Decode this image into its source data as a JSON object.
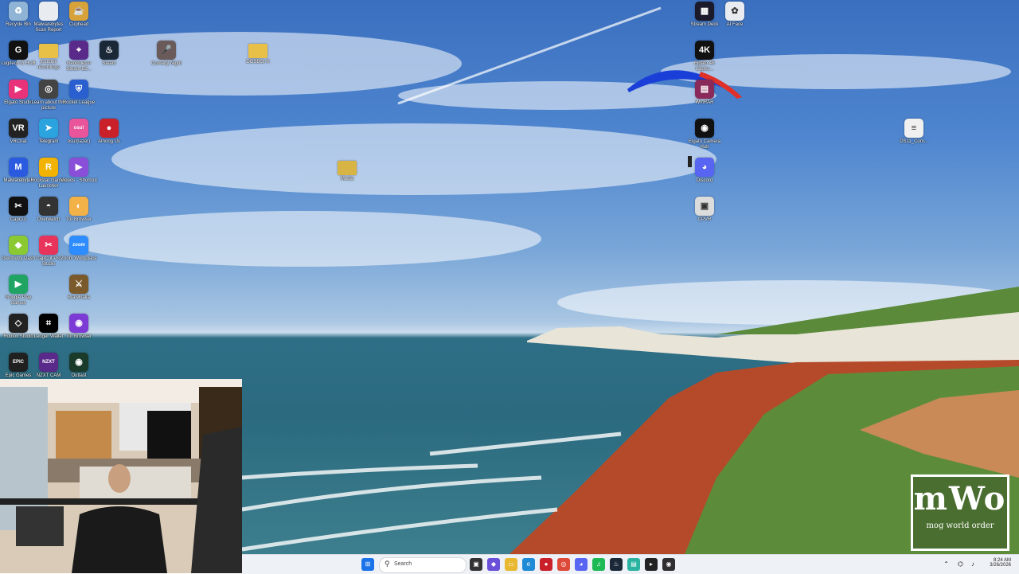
{
  "desktop": {
    "icons": [
      {
        "label": "Recycle Bin",
        "icon": "recycle-bin-icon",
        "color": "#8fb4d6",
        "glyph": "♻"
      },
      {
        "label": "Malwarebytes Scan Report",
        "icon": "document-icon",
        "color": "#e8ecf0",
        "glyph": ""
      },
      {
        "label": "Cuphead",
        "icon": "cuphead-icon",
        "color": "#d8a23a",
        "glyph": "☕"
      },
      {
        "label": "Logitech G HUB",
        "icon": "logitech-ghub-icon",
        "color": "#111111",
        "glyph": "G"
      },
      {
        "label": "youtube recordings",
        "icon": "folder-icon",
        "color": "#e8c048",
        "glyph": ""
      },
      {
        "label": "GeoGuessr Steam Ed...",
        "icon": "geoguessr-icon",
        "color": "#5a2a8a",
        "glyph": "⌖"
      },
      {
        "label": "Steam",
        "icon": "steam-icon",
        "color": "#1b2838",
        "glyph": "♨"
      },
      {
        "label": "Elgato Studio",
        "icon": "elgato-studio-icon",
        "color": "#e8337a",
        "glyph": "▶"
      },
      {
        "label": "Learn about this picture",
        "icon": "camera-icon",
        "color": "#444444",
        "glyph": "◎"
      },
      {
        "label": "Rocket League",
        "icon": "rocket-league-icon",
        "color": "#2a5fcf",
        "glyph": "⛨"
      },
      {
        "label": "VRChat",
        "icon": "vrchat-icon",
        "color": "#222222",
        "glyph": "VR"
      },
      {
        "label": "Telegram",
        "icon": "telegram-icon",
        "color": "#2aa3de",
        "glyph": "➤"
      },
      {
        "label": "osu!(lazer)",
        "icon": "osu-icon",
        "color": "#e9559b",
        "glyph": "osu!"
      },
      {
        "label": "Among Us",
        "icon": "among-us-icon",
        "color": "#c9202a",
        "glyph": "●"
      },
      {
        "label": "Malwarebytes",
        "icon": "malwarebytes-icon",
        "color": "#2a5ae0",
        "glyph": "M"
      },
      {
        "label": "Rockstar Games Launcher",
        "icon": "rockstar-icon",
        "color": "#f2b300",
        "glyph": "R"
      },
      {
        "label": "Videos - Shortcut",
        "icon": "videos-icon",
        "color": "#8a4fd8",
        "glyph": "▶"
      },
      {
        "label": "CapCut",
        "icon": "capcut-icon",
        "color": "#111111",
        "glyph": "✂"
      },
      {
        "label": "Overwatch",
        "icon": "overwatch-icon",
        "color": "#333333",
        "glyph": "◓"
      },
      {
        "label": "Tor Browser",
        "icon": "tor-browser-icon",
        "color": "#f3b247",
        "glyph": "◐"
      },
      {
        "label": "Geometry Dash",
        "icon": "geometry-dash-icon",
        "color": "#8ac932",
        "glyph": "◆"
      },
      {
        "label": "CapCut Pro Studio",
        "icon": "capcut-studio-icon",
        "color": "#e8335a",
        "glyph": "✂"
      },
      {
        "label": "Zoom Workplace",
        "icon": "zoom-icon",
        "color": "#2d8cff",
        "glyph": "zoom"
      },
      {
        "label": "Google Play Games",
        "icon": "google-play-games-icon",
        "color": "#1fa463",
        "glyph": "▶"
      },
      {
        "label": "Brawlhalla",
        "icon": "brawlhalla-icon",
        "color": "#7a5a2a",
        "glyph": "⚔"
      },
      {
        "label": "Roblox Studio",
        "icon": "roblox-studio-icon",
        "color": "#222222",
        "glyph": "◇"
      },
      {
        "label": "Ledger Wallet",
        "icon": "ledger-icon",
        "color": "#000000",
        "glyph": "⌗"
      },
      {
        "label": "Tor Browser",
        "icon": "tor-icon",
        "color": "#7d3bd6",
        "glyph": "◉"
      },
      {
        "label": "Epic Games",
        "icon": "epic-games-icon",
        "color": "#202020",
        "glyph": "EPIC"
      },
      {
        "label": "NZXT CAM",
        "icon": "nzxt-cam-icon",
        "color": "#5a2a8a",
        "glyph": "NZXT"
      },
      {
        "label": "Outlast",
        "icon": "outlast-icon",
        "color": "#1a3a2a",
        "glyph": "◉"
      },
      {
        "label": "Comedy Night",
        "icon": "comedy-night-icon",
        "color": "#6a5a5a",
        "glyph": "🎤"
      },
      {
        "label": "DOSBox-X",
        "icon": "folder-icon",
        "color": "#e8c048",
        "glyph": ""
      },
      {
        "label": "Media",
        "icon": "media-folder-icon",
        "color": "#d8b444",
        "glyph": ""
      },
      {
        "label": "Stream Deck",
        "icon": "stream-deck-icon",
        "color": "#1a1a2a",
        "glyph": "▦"
      },
      {
        "label": "AI Face",
        "icon": "ai-face-icon",
        "color": "#e8ecf0",
        "glyph": "✿"
      },
      {
        "label": "Elgato 4K Captur...",
        "icon": "elgato-4k-icon",
        "color": "#111111",
        "glyph": "4K"
      },
      {
        "label": "WinRAR",
        "icon": "winrar-icon",
        "color": "#8a2a5a",
        "glyph": "▤"
      },
      {
        "label": "Elgato Camera Hub",
        "icon": "elgato-camera-hub-icon",
        "color": "#111111",
        "glyph": "◉"
      },
      {
        "label": "Discord",
        "icon": "discord-icon",
        "color": "#5865f2",
        "glyph": "◕"
      },
      {
        "label": "CPVR",
        "icon": "cpvr-icon",
        "color": "#dcdcdc",
        "glyph": "▣"
      },
      {
        "label": "DS11_Com...",
        "icon": "document-icon",
        "color": "#f0f0f0",
        "glyph": "≡"
      }
    ]
  },
  "watermark": {
    "big": "mWo",
    "small": "mog world order"
  },
  "taskbar": {
    "search_placeholder": "Search",
    "apps": [
      {
        "name": "windows-start-icon",
        "color": "#1a73e8",
        "glyph": "⊞"
      },
      {
        "name": "widgets-icon",
        "color": "#7cb342",
        "glyph": "☘"
      },
      {
        "name": "task-view-icon",
        "color": "#333333",
        "glyph": "▣"
      },
      {
        "name": "copilot-icon",
        "color": "#6a4fd8",
        "glyph": "◆"
      },
      {
        "name": "file-explorer-icon",
        "color": "#e8b830",
        "glyph": "▭"
      },
      {
        "name": "edge-icon",
        "color": "#1f8ad6",
        "glyph": "e"
      },
      {
        "name": "recording-app-icon",
        "color": "#c9202a",
        "glyph": "●"
      },
      {
        "name": "chrome-icon",
        "color": "#de4a3a",
        "glyph": "◎"
      },
      {
        "name": "discord-taskbar-icon",
        "color": "#5865f2",
        "glyph": "◕"
      },
      {
        "name": "spotify-icon",
        "color": "#1db954",
        "glyph": "♫"
      },
      {
        "name": "steam-taskbar-icon",
        "color": "#1b2838",
        "glyph": "♨"
      },
      {
        "name": "notepad-icon",
        "color": "#2ab3a0",
        "glyph": "▤"
      },
      {
        "name": "terminal-icon",
        "color": "#222222",
        "glyph": "▸"
      },
      {
        "name": "obs-icon",
        "color": "#302e31",
        "glyph": "◉"
      }
    ],
    "time": "8:24 AM",
    "date": "3/26/2026"
  }
}
